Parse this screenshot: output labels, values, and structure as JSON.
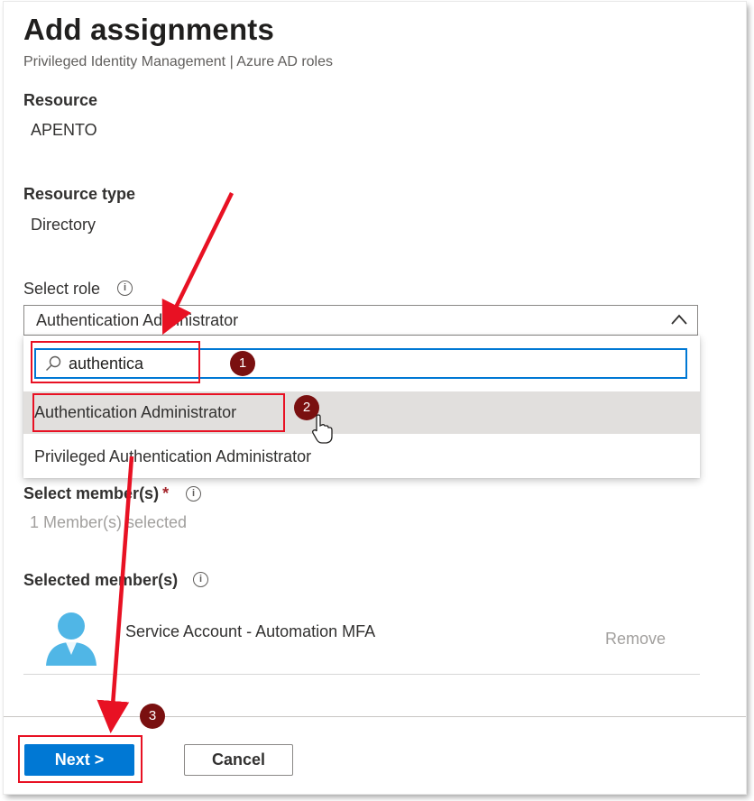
{
  "header": {
    "title": "Add assignments",
    "subtitle": "Privileged Identity Management | Azure AD roles"
  },
  "resource": {
    "label": "Resource",
    "value": "APENTO"
  },
  "resource_type": {
    "label": "Resource type",
    "value": "Directory"
  },
  "role": {
    "label": "Select role",
    "selected": "Authentication Administrator",
    "search_value": "authentica",
    "options": [
      "Authentication Administrator",
      "Privileged Authentication Administrator"
    ]
  },
  "members": {
    "label": "Select member(s)",
    "required_mark": "*",
    "selected_text": "1 Member(s) selected"
  },
  "selected_members": {
    "label": "Selected member(s)",
    "items": [
      {
        "name": "Service Account - Automation MFA",
        "remove_label": "Remove"
      }
    ]
  },
  "footer": {
    "next_label": "Next >",
    "cancel_label": "Cancel"
  },
  "annotations": {
    "badge1": "1",
    "badge2": "2",
    "badge3": "3"
  },
  "colors": {
    "accent": "#0078d4",
    "annotation_red": "#e81123",
    "badge": "#7a1010"
  }
}
